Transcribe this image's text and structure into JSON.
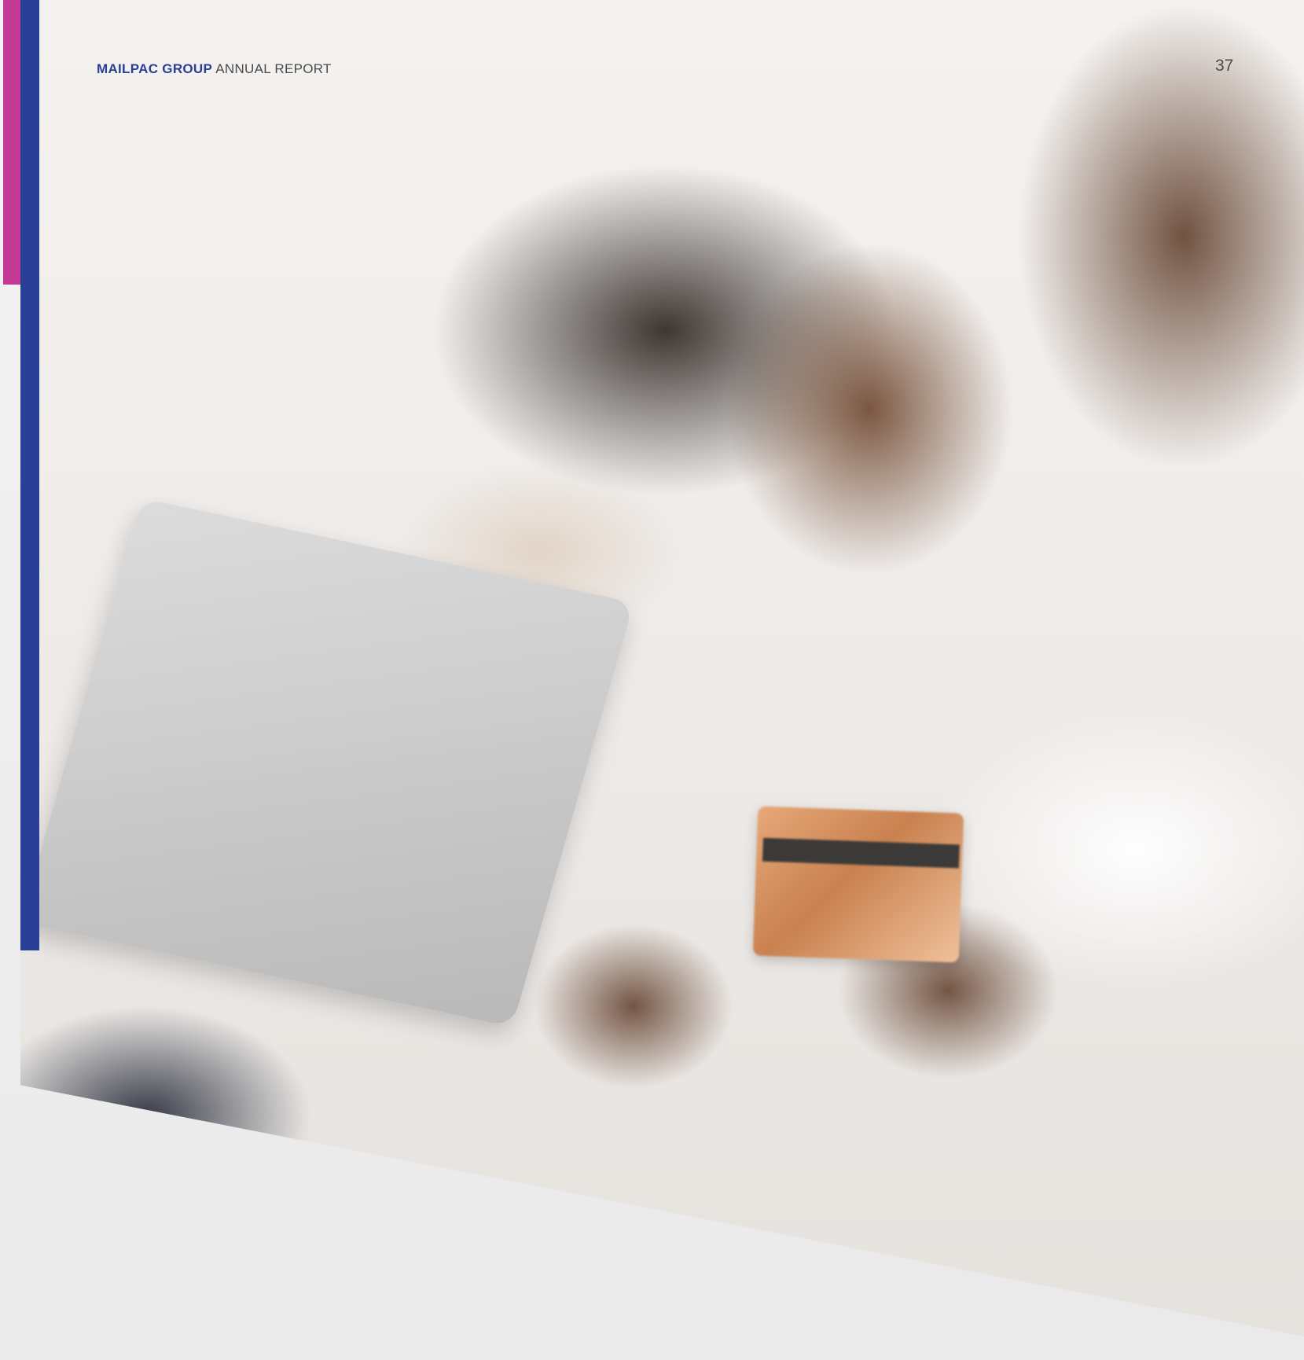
{
  "header": {
    "brand": "MAILPAC GROUP",
    "subtitle": "ANNUAL REPORT"
  },
  "page_number": "37",
  "colors": {
    "accent_blue": "#2a3f96",
    "accent_magenta": "#c63a97",
    "background": "#efefef"
  },
  "photo": {
    "subject": "couple-shopping-online-icon"
  }
}
